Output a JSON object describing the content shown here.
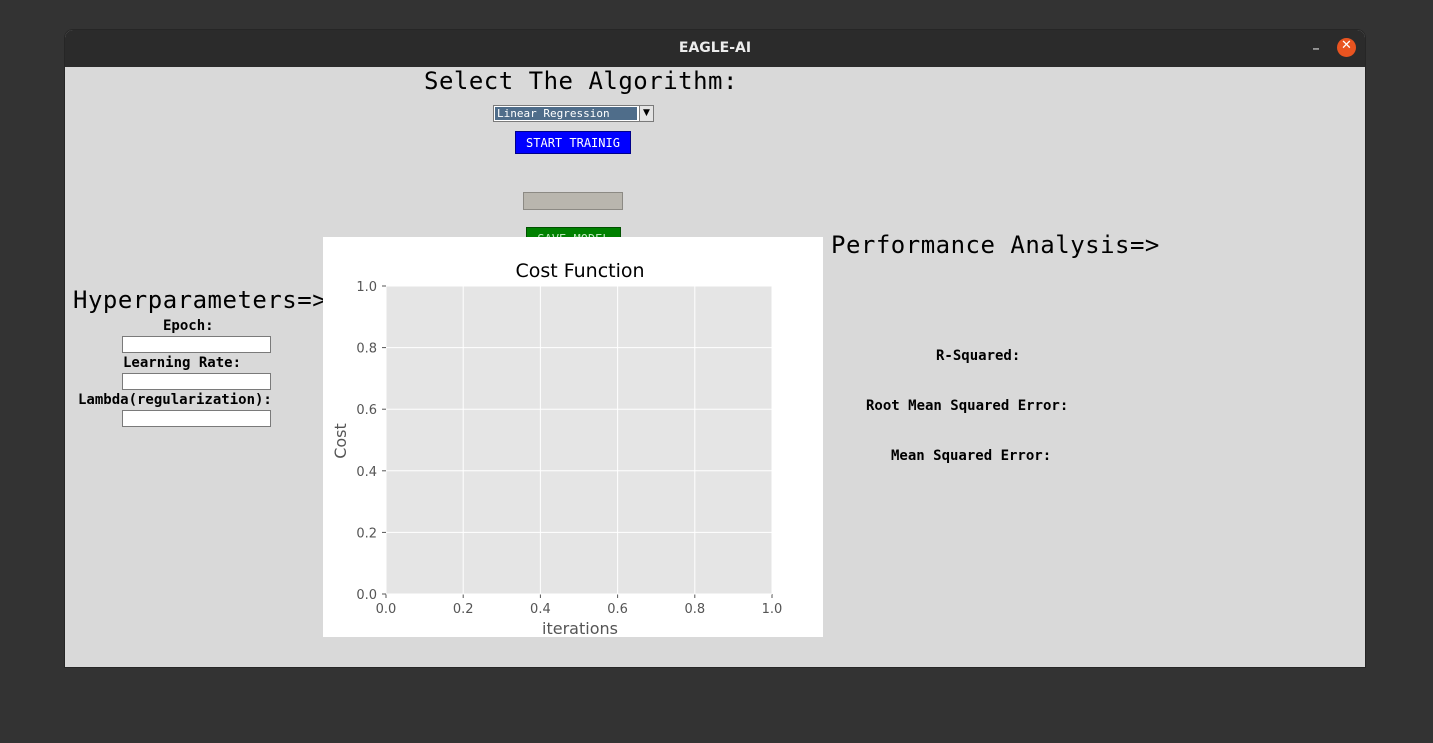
{
  "window": {
    "title": "EAGLE-AI",
    "minimize_glyph": "–",
    "close_glyph": "✕",
    "close_color": "#e95420"
  },
  "algorithm": {
    "heading": "Select The Algorithm:",
    "selected": "Linear Regression",
    "start_label": "START TRAINIG",
    "progress_value": 0,
    "save_label": "SAVE MODEL"
  },
  "hyperparameters": {
    "heading": "Hyperparameters=>",
    "epoch_label": "Epoch:",
    "epoch_value": "",
    "learning_rate_label": "Learning Rate:",
    "learning_rate_value": "",
    "lambda_label": "Lambda(regularization):",
    "lambda_value": ""
  },
  "performance": {
    "heading": "Performance Analysis=>",
    "r_squared_label": "R-Squared:",
    "rmse_label": "Root Mean Squared Error:",
    "mse_label": "Mean Squared Error:"
  },
  "chart_data": {
    "type": "line",
    "title": "Cost Function",
    "xlabel": "iterations",
    "ylabel": "Cost",
    "xlim": [
      0,
      1
    ],
    "ylim": [
      0,
      1
    ],
    "xticks": [
      "0.0",
      "0.2",
      "0.4",
      "0.6",
      "0.8",
      "1.0"
    ],
    "yticks": [
      "0.0",
      "0.2",
      "0.4",
      "0.6",
      "0.8",
      "1.0"
    ],
    "grid": true,
    "series": []
  },
  "colors": {
    "start_button": "#0000ff",
    "save_button": "#008000",
    "plot_bg": "#e5e5e5"
  }
}
